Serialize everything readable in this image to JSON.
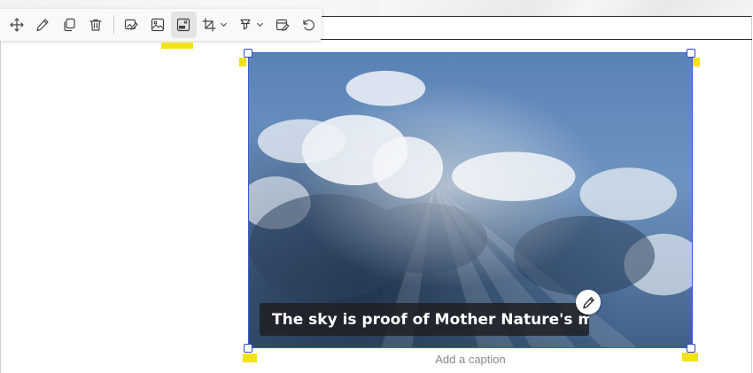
{
  "toolbar": {
    "buttons": [
      {
        "name": "move",
        "icon": "move-arrows-icon"
      },
      {
        "name": "edit",
        "icon": "pencil-icon"
      },
      {
        "name": "duplicate",
        "icon": "copy-icon"
      },
      {
        "name": "delete",
        "icon": "trash-icon"
      },
      {
        "name": "alt-text",
        "icon": "image-edit-icon"
      },
      {
        "name": "replace-image",
        "icon": "image-replace-icon"
      },
      {
        "name": "text-on-image",
        "icon": "image-caption-icon",
        "active": true
      },
      {
        "name": "crop",
        "icon": "crop-icon",
        "dropdown": true
      },
      {
        "name": "filters",
        "icon": "filter-icon",
        "dropdown": true
      },
      {
        "name": "style",
        "icon": "style-edit-icon"
      },
      {
        "name": "reset",
        "icon": "undo-icon"
      }
    ]
  },
  "image": {
    "overlay_text": "The sky is proof of Mother Nature's majesty",
    "caption_placeholder": "Add a caption"
  },
  "colors": {
    "selection": "#3a5bd9",
    "highlight": "#f2e21a",
    "overlay_bg": "#1e2024"
  }
}
